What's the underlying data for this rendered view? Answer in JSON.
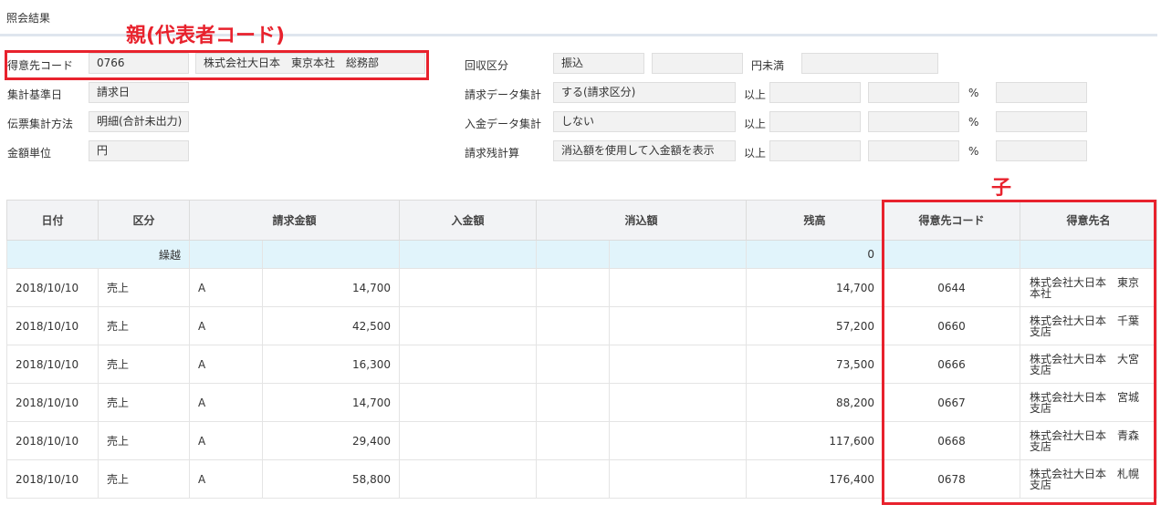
{
  "page_title": "照会結果",
  "annotations": {
    "parent": "親(代表者コード)",
    "child": "子"
  },
  "form": {
    "customer_code_label": "得意先コード",
    "customer_code": "0766",
    "customer_name": "株式会社大日本　東京本社　総務部",
    "agg_basis_label": "集計基準日",
    "agg_basis": "請求日",
    "slip_method_label": "伝票集計方法",
    "slip_method": "明細(合計未出力)",
    "amount_unit_label": "金額単位",
    "amount_unit": "円",
    "collection_label": "回収区分",
    "collection_value": "振込",
    "collection_value2": "",
    "collection_unit": "円未満",
    "collection_value3": "",
    "billing_data_label": "請求データ集計",
    "billing_data_value": "する(請求区分)",
    "billing_data_above": "以上",
    "billing_data_pct": "%",
    "payment_data_label": "入金データ集計",
    "payment_data_value": "しない",
    "payment_data_above": "以上",
    "payment_data_pct": "%",
    "billing_balance_label": "請求残計算",
    "billing_balance_value": "消込額を使用して入金額を表示",
    "billing_balance_above": "以上",
    "billing_balance_pct": "%"
  },
  "table": {
    "headers": [
      "日付",
      "区分",
      "請求金額",
      "入金額",
      "消込額",
      "残高",
      "得意先コード",
      "得意先名"
    ],
    "carry_label": "繰越",
    "carry_balance": "0",
    "rows": [
      {
        "date": "2018/10/10",
        "type": "売上",
        "tax": "A",
        "billing": "14,700",
        "balance": "14,700",
        "code": "0644",
        "name1": "株式会社大日本　東京",
        "name2": "本社"
      },
      {
        "date": "2018/10/10",
        "type": "売上",
        "tax": "A",
        "billing": "42,500",
        "balance": "57,200",
        "code": "0660",
        "name1": "株式会社大日本　千葉",
        "name2": "支店"
      },
      {
        "date": "2018/10/10",
        "type": "売上",
        "tax": "A",
        "billing": "16,300",
        "balance": "73,500",
        "code": "0666",
        "name1": "株式会社大日本　大宮",
        "name2": "支店"
      },
      {
        "date": "2018/10/10",
        "type": "売上",
        "tax": "A",
        "billing": "14,700",
        "balance": "88,200",
        "code": "0667",
        "name1": "株式会社大日本　宮城",
        "name2": "支店"
      },
      {
        "date": "2018/10/10",
        "type": "売上",
        "tax": "A",
        "billing": "29,400",
        "balance": "117,600",
        "code": "0668",
        "name1": "株式会社大日本　青森",
        "name2": "支店"
      },
      {
        "date": "2018/10/10",
        "type": "売上",
        "tax": "A",
        "billing": "58,800",
        "balance": "176,400",
        "code": "0678",
        "name1": "株式会社大日本　札幌",
        "name2": "支店"
      }
    ]
  }
}
